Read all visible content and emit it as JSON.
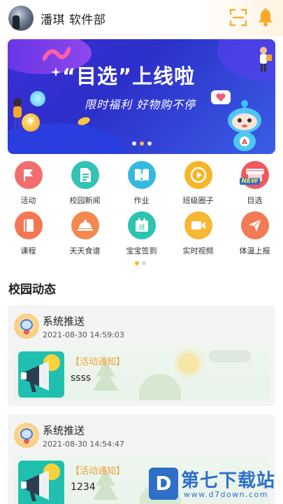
{
  "header": {
    "user_name": "潘琪 软件部",
    "scan_icon": "scan-icon",
    "bell_icon": "bell-icon",
    "accent_color": "#f7a928"
  },
  "banner": {
    "title": "“目选”上线啦",
    "subtitle": "限时福利 好物购不停",
    "coin_symbol": "¥",
    "robot_letter": "A",
    "slides": 3,
    "active_slide": 2
  },
  "grid": {
    "items": [
      {
        "label": "活动",
        "icon": "flag-icon",
        "color": "#f26d6d"
      },
      {
        "label": "校园新闻",
        "icon": "document-icon",
        "color": "#33c3b6"
      },
      {
        "label": "作业",
        "icon": "book-icon",
        "color": "#34b8e0"
      },
      {
        "label": "班级圈子",
        "icon": "play-icon",
        "color": "#f7b52a"
      },
      {
        "label": "目选",
        "icon": "shop-new-icon",
        "color": "#f0595f",
        "badge": "NEW"
      },
      {
        "label": "课程",
        "icon": "course-book-icon",
        "color": "#f37754"
      },
      {
        "label": "天天食谱",
        "icon": "food-cover-icon",
        "color": "#f3894f"
      },
      {
        "label": "宝宝签到",
        "icon": "calendar-icon",
        "color": "#2cc3b0",
        "calendar_text": "班"
      },
      {
        "label": "实时视频",
        "icon": "video-camera-icon",
        "color": "#f7b733"
      },
      {
        "label": "体温上报",
        "icon": "send-icon",
        "color": "#f37a55"
      }
    ],
    "pages": 2,
    "active_page": 1
  },
  "section": {
    "title": "校园动态"
  },
  "feed": [
    {
      "sender": "系统推送",
      "time": "2021-08-30 14:59:03",
      "tag": "【活动通知】",
      "text": "ssss"
    },
    {
      "sender": "系统推送",
      "time": "2021-08-30 14:54:47",
      "tag": "【活动通知】",
      "text": "1234"
    }
  ],
  "watermark": {
    "logo_letter": "D",
    "name": "第七下载站",
    "url": "www.d7down.com",
    "color": "#2f6fc8"
  }
}
